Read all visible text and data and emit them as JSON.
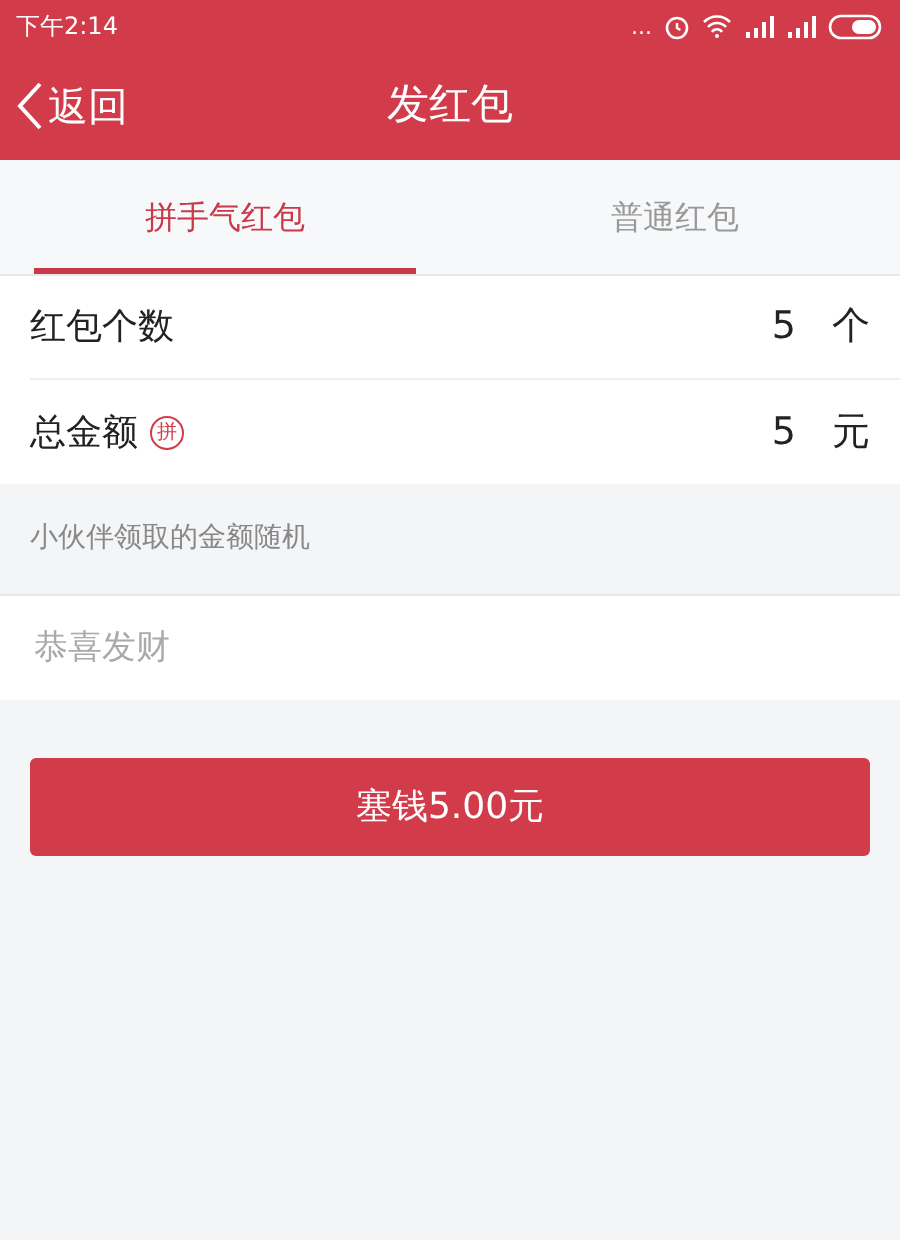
{
  "status_bar": {
    "time": "下午2:14",
    "dots": "..."
  },
  "nav": {
    "back": "返回",
    "title": "发红包"
  },
  "tabs": [
    {
      "label": "拼手气红包",
      "selected": true
    },
    {
      "label": "普通红包",
      "selected": false
    }
  ],
  "rows": [
    {
      "label": "红包个数",
      "badge": null,
      "value": "5",
      "unit": "个"
    },
    {
      "label": "总金额",
      "badge": "拼",
      "value": "5",
      "unit": "元"
    }
  ],
  "hint": "小伙伴领取的金额随机",
  "message": {
    "placeholder": "恭喜发财"
  },
  "submit": "塞钱5.00元"
}
